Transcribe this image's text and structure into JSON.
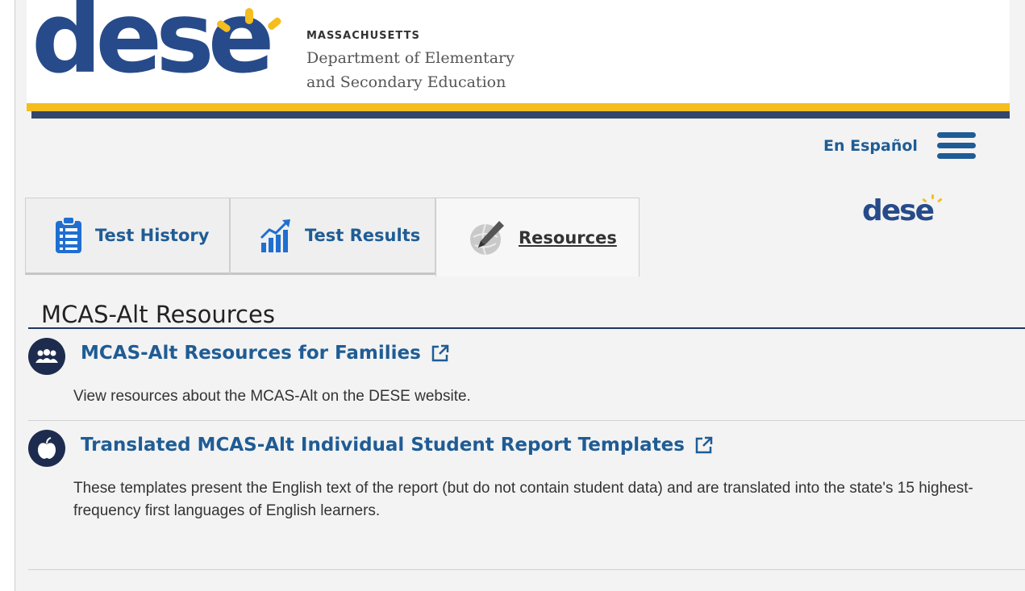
{
  "header": {
    "logo_text": "dese",
    "state": "MASSACHUSETTS",
    "agency_name": "Department of Elementary\nand Secondary Education",
    "colors": {
      "brand": "#274b8a",
      "sun": "#f5bd1e",
      "stripe_navy": "#34476b"
    }
  },
  "utility": {
    "language_link": "En Español",
    "menu_icon": "hamburger-menu-icon",
    "mini_logo_text": "dese"
  },
  "tabs": [
    {
      "label": "Test History",
      "icon": "clipboard-list-icon",
      "active": false
    },
    {
      "label": "Test Results",
      "icon": "bar-chart-icon",
      "active": false
    },
    {
      "label": "Resources",
      "icon": "pencil-globe-icon",
      "active": true
    }
  ],
  "section": {
    "title": "MCAS-Alt Resources",
    "items": [
      {
        "title": "MCAS-Alt Resources for Families",
        "icon": "family-group-icon",
        "link_icon": "external-link-icon",
        "description": "View resources about the MCAS-Alt on the DESE website."
      },
      {
        "title": "Translated MCAS-Alt Individual Student Report Templates",
        "icon": "apple-icon",
        "link_icon": "external-link-icon",
        "description": "These templates present the English text of the report (but do not contain student data) and are translated into the state's 15 highest-frequency first languages of English learners."
      }
    ]
  }
}
